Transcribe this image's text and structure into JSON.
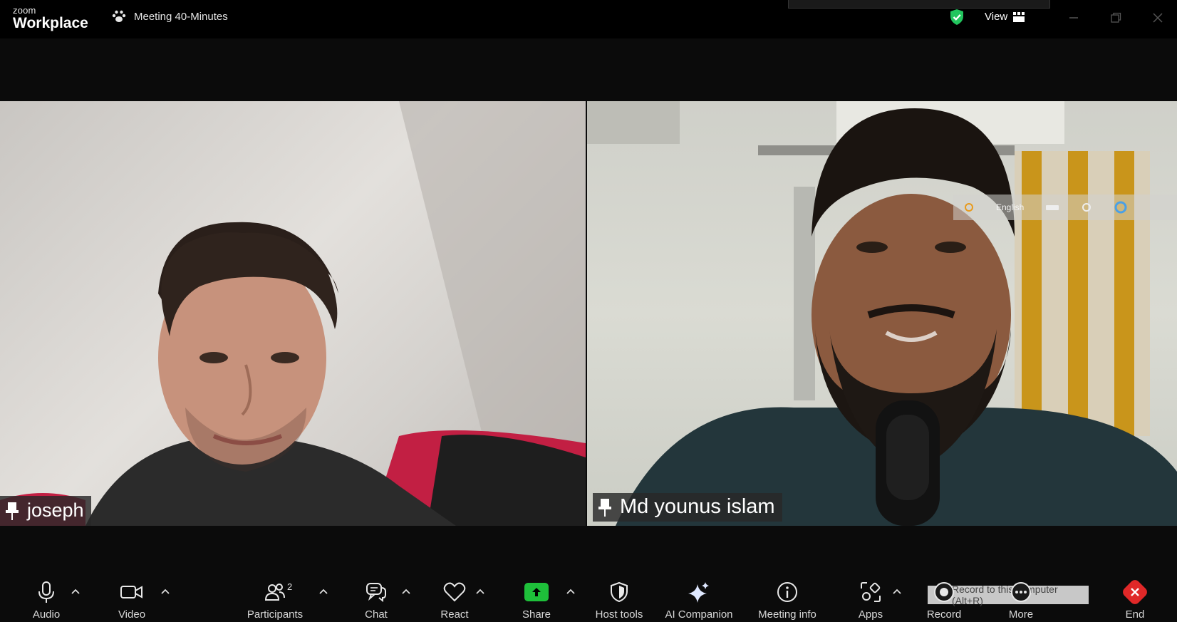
{
  "app": {
    "brand_small": "zoom",
    "brand_big": "Workplace",
    "meeting_title": "Meeting 40-Minutes",
    "view_label": "View"
  },
  "participants": [
    {
      "name": "joseph"
    },
    {
      "name": "Md younus islam"
    }
  ],
  "overlay": {
    "language": "English"
  },
  "toolbar": {
    "audio": "Audio",
    "video": "Video",
    "participants": "Participants",
    "participant_count": "2",
    "chat": "Chat",
    "react": "React",
    "share": "Share",
    "host_tools": "Host tools",
    "ai_companion": "AI Companion",
    "meeting_info": "Meeting info",
    "apps": "Apps",
    "record": "Record",
    "more": "More",
    "end": "End",
    "record_tooltip": "Record to this computer (Alt+R)"
  },
  "colors": {
    "share_green": "#1ec03a",
    "end_red": "#e02828",
    "shield_green": "#22c55e",
    "toolbar_bg": "#0b0b0b"
  }
}
